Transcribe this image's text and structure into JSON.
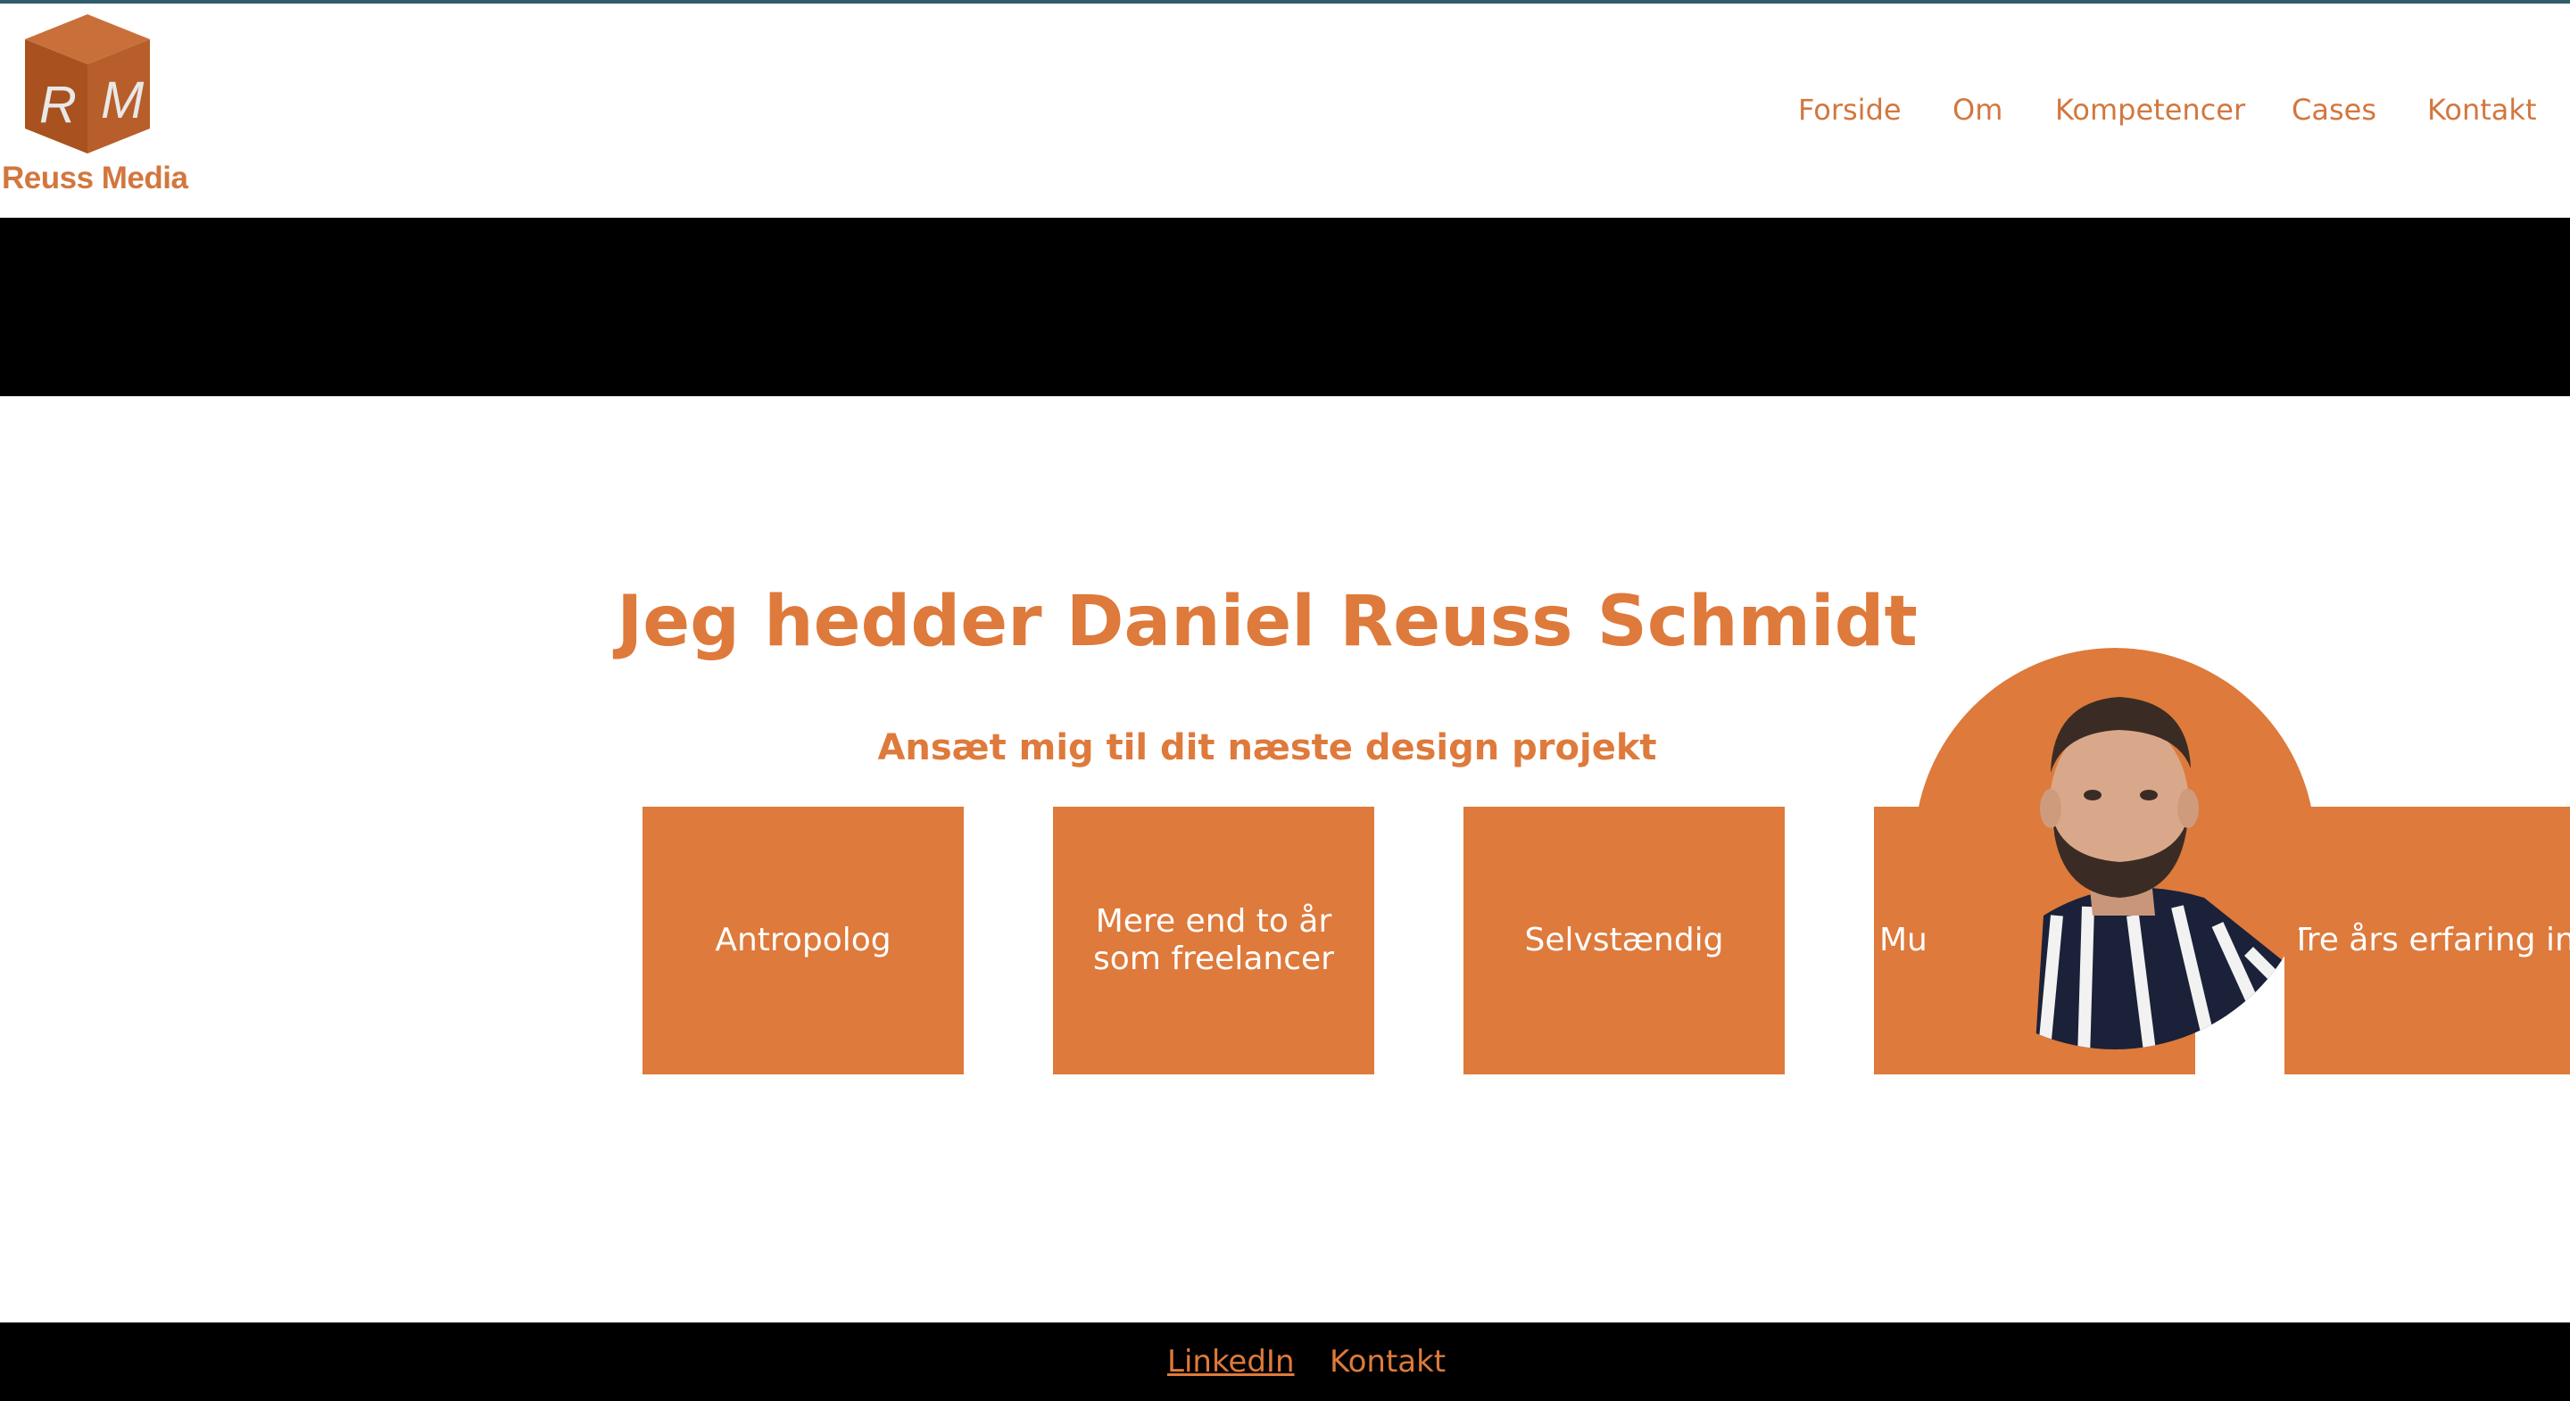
{
  "brand": {
    "name": "Reuss Media",
    "monogram_left": "R",
    "monogram_right": "M",
    "cube_color": "#b45a26"
  },
  "nav": {
    "items": [
      {
        "label": "Forside"
      },
      {
        "label": "Om"
      },
      {
        "label": "Kompetencer"
      },
      {
        "label": "Cases"
      },
      {
        "label": "Kontakt"
      }
    ]
  },
  "hero": {
    "title": "Jeg hedder Daniel Reuss Schmidt",
    "subtitle": "Ansæt mig til dit næste design projekt"
  },
  "cards": [
    {
      "label": "Antropolog"
    },
    {
      "label": "Mere end to år som freelancer"
    },
    {
      "label": "Selvstændig"
    },
    {
      "label": "Mu"
    },
    {
      "label": "Tre års erfaring inden for marketin"
    }
  ],
  "footer": {
    "links": [
      {
        "label": "LinkedIn"
      },
      {
        "label": "Kontakt"
      }
    ]
  },
  "colors": {
    "accent": "#de7a3b",
    "band": "#000000",
    "top_line": "#2f5d6b"
  }
}
